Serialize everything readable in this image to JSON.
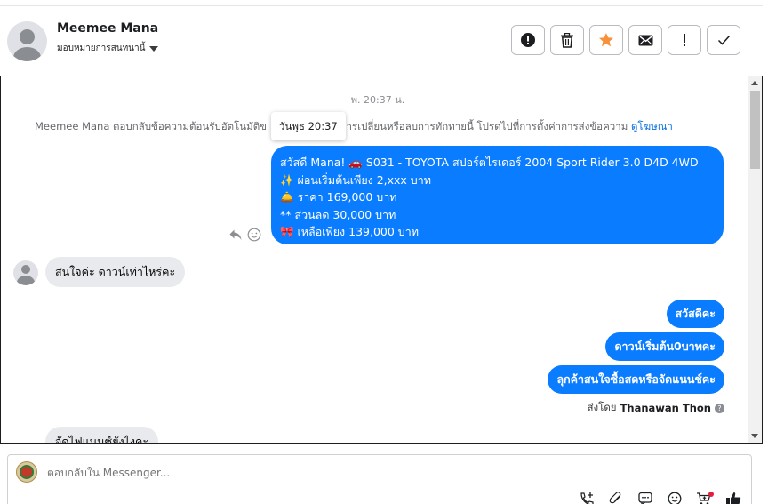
{
  "header": {
    "contact_name": "Meemee Mana",
    "assign_label": "มอบหมายการสนทนานี้",
    "actions": [
      {
        "name": "spam-button",
        "icon": "alert-circle-icon"
      },
      {
        "name": "delete-button",
        "icon": "trash-icon"
      },
      {
        "name": "star-button",
        "icon": "star-icon",
        "color": "#f7923b"
      },
      {
        "name": "mark-unread-button",
        "icon": "envelope-icon"
      },
      {
        "name": "follow-up-button",
        "icon": "exclamation-icon"
      },
      {
        "name": "done-button",
        "icon": "check-icon"
      }
    ]
  },
  "conversation": {
    "timestamp": "พ. 20:37 น.",
    "tooltip": "วันพุธ 20:37",
    "notice_before": "Meemee Mana ตอบกลับข้อความต้อนรับอัตโนมัติข",
    "notice_after": "้องการเปลี่ยนหรือลบการทักทายนี้ โปรดไปที่การตั้งค่าการส่งข้อความ ",
    "notice_link": "ดูโฆษณา",
    "greeting_lines": [
      "สวัสดี Mana! 🚗 S031 - TOYOTA สปอร์ตไรเดอร์ 2004 Sport Rider 3.0 D4D 4WD",
      "✨ ผ่อนเริ่มต้นเพียง 2,xxx บาท",
      "🛎️ ราคา 169,000 บาท",
      "** ส่วนลด 30,000 บาท",
      "🎀 เหลือเพียง 139,000 บาท"
    ],
    "incoming_1": "สนใจค่ะ ดาวน์เท่าไหร่คะ",
    "outgoing": [
      "สวัสดีคะ",
      "ดาวน์เริ่มต้น0บาทคะ",
      "ลุกค้าสนใจซื้อสดหรือจัดแนนช์คะ"
    ],
    "sent_by_prefix": "ส่งโดย",
    "sent_by_name": "Thanawan Thon",
    "incoming_2": "จัดไฟแนนซ์ยังไงคะ"
  },
  "composer": {
    "placeholder": "ตอบกลับใน Messenger..."
  },
  "colors": {
    "accent": "#0a7cff",
    "link": "#0a6fe0",
    "incoming_bubble": "#e9eaed"
  }
}
